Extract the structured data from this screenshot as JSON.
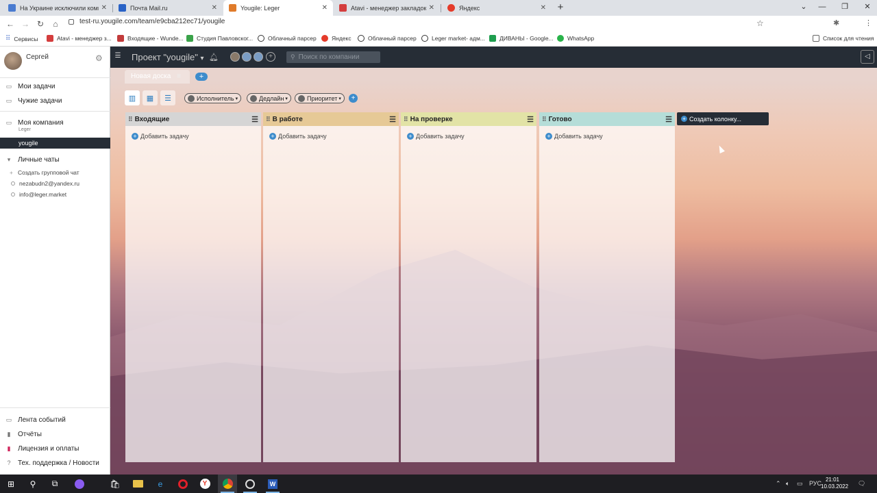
{
  "browser": {
    "tabs": [
      {
        "title": "На Украине исключили компр",
        "fav_color": "#4a7bd0"
      },
      {
        "title": "Почта Mail.ru",
        "fav_color": "#2962c6"
      },
      {
        "title": "Yougile: Leger",
        "fav_color": "#e07b2a",
        "active": true
      },
      {
        "title": "Atavi - менеджер закладок",
        "fav_color": "#d43d3d"
      },
      {
        "title": "Яндекс",
        "fav_color": "#e53b2a"
      }
    ],
    "tab_close": "✕",
    "new_tab": "+",
    "url": "test-ru.yougile.com/team/e9cba212ec71/yougile",
    "bookmarks": [
      {
        "label": "Сервисы",
        "color": "#6b8ed6"
      },
      {
        "label": "Atavi - менеджер з...",
        "color": "#d43d3d"
      },
      {
        "label": "Входящие - Wunde...",
        "color": "#c23b3b"
      },
      {
        "label": "Студия Павловског...",
        "color": "#3aa34a"
      },
      {
        "label": "Облачный парсер",
        "color": "#333333"
      },
      {
        "label": "Яндекс",
        "color": "#e53b2a"
      },
      {
        "label": "Облачный парсер",
        "color": "#333333"
      },
      {
        "label": "Leger market- адм...",
        "color": "#333333"
      },
      {
        "label": "ДИВАНЫ - Google...",
        "color": "#1e9e4f"
      },
      {
        "label": "WhatsApp",
        "color": "#29b34a"
      }
    ],
    "reading_list": "Список для чтения"
  },
  "sidebar": {
    "user_name": "Сергей",
    "my_tasks": "Мои задачи",
    "others_tasks": "Чужие задачи",
    "company": "Моя компания",
    "company_sub": "Leger",
    "active_project": "yougile",
    "personal_chats": "Личные чаты",
    "create_group_chat": "Создать групповой чат",
    "contacts": [
      "nezabudn2@yandex.ru",
      "info@leger.market"
    ],
    "events": "Лента событий",
    "reports": "Отчёты",
    "license": "Лицензия и оплаты",
    "support": "Тех. поддержка / Новости"
  },
  "header": {
    "project_title": "Проект \"yougile\"",
    "search_placeholder": "Поиск по компании"
  },
  "board": {
    "tab_label": "Новая доска",
    "filters": [
      "Исполнитель",
      "Дедлайн",
      "Приоритет"
    ],
    "add_task_label": "Добавить задачу",
    "create_column_label": "Создать колонку...",
    "columns": [
      {
        "name": "Входящие",
        "color": "#d5d5d5"
      },
      {
        "name": "В работе",
        "color": "#e6c996"
      },
      {
        "name": "На проверке",
        "color": "#e2e3a6"
      },
      {
        "name": "Готово",
        "color": "#b5ddd8"
      }
    ]
  },
  "taskbar": {
    "lang": "РУС",
    "time": "21:01",
    "date": "10.03.2022"
  }
}
